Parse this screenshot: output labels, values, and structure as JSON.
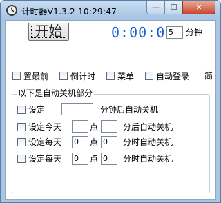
{
  "window": {
    "title": "计时器V1.3.2 10:29:47",
    "min_glyph": "—",
    "max_glyph": "☐",
    "close_glyph": "✕"
  },
  "timer": {
    "start_label": "开始",
    "clock": "0:00:00",
    "minutes_value": "5",
    "minutes_unit": "分钟"
  },
  "options": {
    "topmost": "置最前",
    "countdown": "倒计时",
    "menu": "菜单",
    "autologin": "自动登录",
    "simplified": "简"
  },
  "shutdown": {
    "group_title": "以下是自动关机部分",
    "rows": [
      {
        "label": "设定",
        "suffix": "分钟后自动关机",
        "value": ""
      },
      {
        "label": "设定今天",
        "hour": "",
        "point": "点",
        "minute": "",
        "suffix": "分后自动关机"
      },
      {
        "label": "设定每天",
        "hour": "0",
        "point": "点",
        "minute": "0",
        "suffix": "分时自动关机"
      },
      {
        "label": "设定每天",
        "hour": "0",
        "point": "点",
        "minute": "0",
        "suffix": "分时自动关机"
      }
    ]
  }
}
